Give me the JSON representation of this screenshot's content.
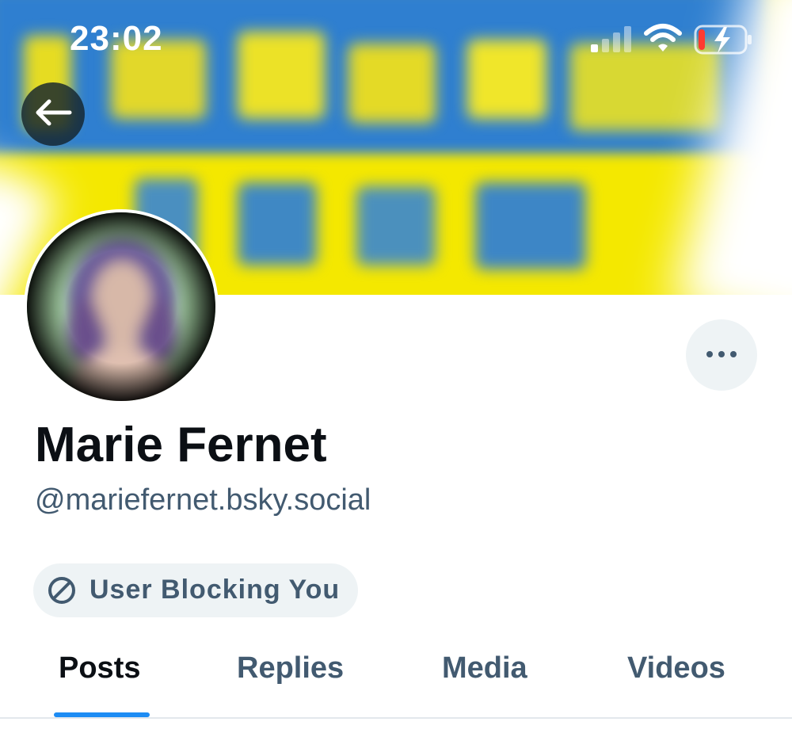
{
  "status_bar": {
    "time": "23:02",
    "signal_icon": "signal-icon",
    "wifi_icon": "wifi-icon",
    "battery_icon": "battery-charging-icon",
    "battery_color": "#ff3b30"
  },
  "header": {
    "back_icon": "arrow-left-icon"
  },
  "profile": {
    "display_name": "Marie Fernet",
    "handle": "@mariefernet.bsky.social",
    "more_icon": "ellipsis-icon",
    "blocking_badge": {
      "icon": "block-icon",
      "label": "User Blocking You"
    }
  },
  "tabs": [
    {
      "label": "Posts",
      "active": true
    },
    {
      "label": "Replies",
      "active": false
    },
    {
      "label": "Media",
      "active": false
    },
    {
      "label": "Videos",
      "active": false
    }
  ],
  "colors": {
    "accent": "#1d8cf4",
    "text_primary": "#0b0f14",
    "text_secondary": "#425a70",
    "chip_background": "#eef3f5"
  }
}
